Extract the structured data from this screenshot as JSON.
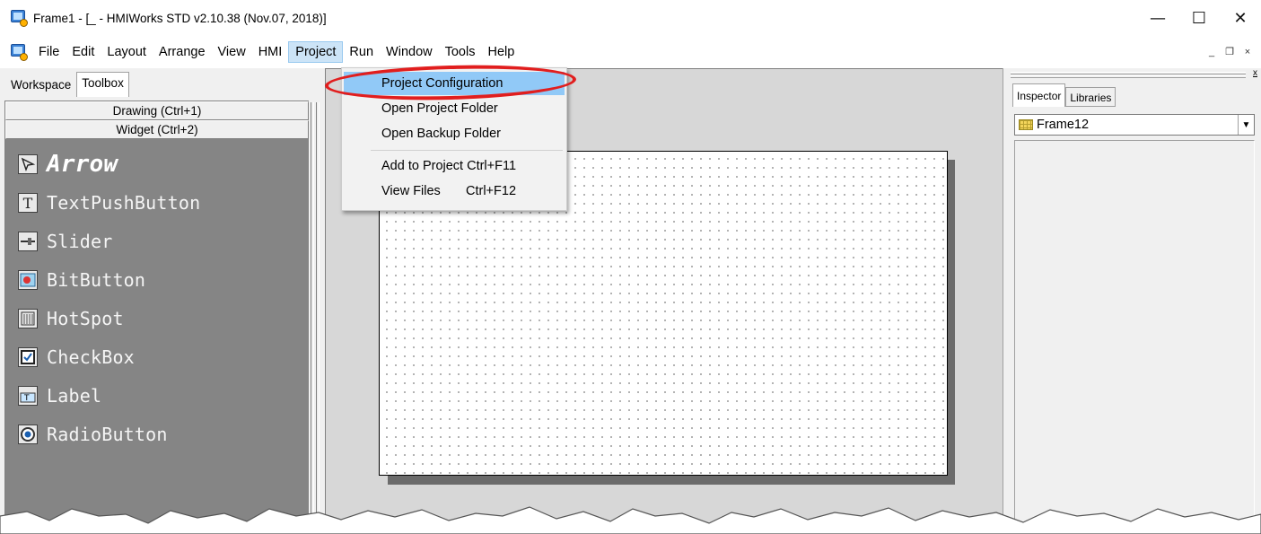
{
  "window": {
    "title": "Frame1 - [_ - HMIWorks STD v2.10.38 (Nov.07, 2018)]",
    "controls": {
      "minimize": "—",
      "maximize": "☐",
      "close": "✕"
    }
  },
  "menubar": {
    "items": [
      "File",
      "Edit",
      "Layout",
      "Arrange",
      "View",
      "HMI",
      "Project",
      "Run",
      "Window",
      "Tools",
      "Help"
    ],
    "active": "Project",
    "mdi_controls": {
      "minimize": "_",
      "restore": "❐",
      "close": "×"
    }
  },
  "project_menu": {
    "items": [
      {
        "label": "Project Configuration",
        "highlighted": true
      },
      {
        "label": "Open Project Folder"
      },
      {
        "label": "Open Backup Folder"
      },
      {
        "label": "Add to Project Ctrl+F11"
      },
      {
        "label": "View Files       Ctrl+F12"
      }
    ]
  },
  "left_panel": {
    "tabs": [
      "Workspace",
      "Toolbox"
    ],
    "active_tab": "Toolbox",
    "sections": [
      "Drawing (Ctrl+1)",
      "Widget (Ctrl+2)"
    ],
    "tools": [
      {
        "label": "Arrow",
        "icon": "arrow-icon",
        "selected": true
      },
      {
        "label": "TextPushButton",
        "icon": "text-push-button-icon"
      },
      {
        "label": "Slider",
        "icon": "slider-icon"
      },
      {
        "label": "BitButton",
        "icon": "bit-button-icon"
      },
      {
        "label": "HotSpot",
        "icon": "hotspot-icon"
      },
      {
        "label": "CheckBox",
        "icon": "checkbox-icon"
      },
      {
        "label": "Label",
        "icon": "label-icon"
      },
      {
        "label": "RadioButton",
        "icon": "radio-button-icon"
      }
    ]
  },
  "right_panel": {
    "tabs": [
      "Inspector",
      "Libraries"
    ],
    "active_tab": "Inspector",
    "close": "x",
    "selected_object": "Frame12"
  },
  "colors": {
    "menu_highlight": "#91c9f7",
    "annotation": "#e11e1e",
    "toolbox_bg": "#858585"
  }
}
